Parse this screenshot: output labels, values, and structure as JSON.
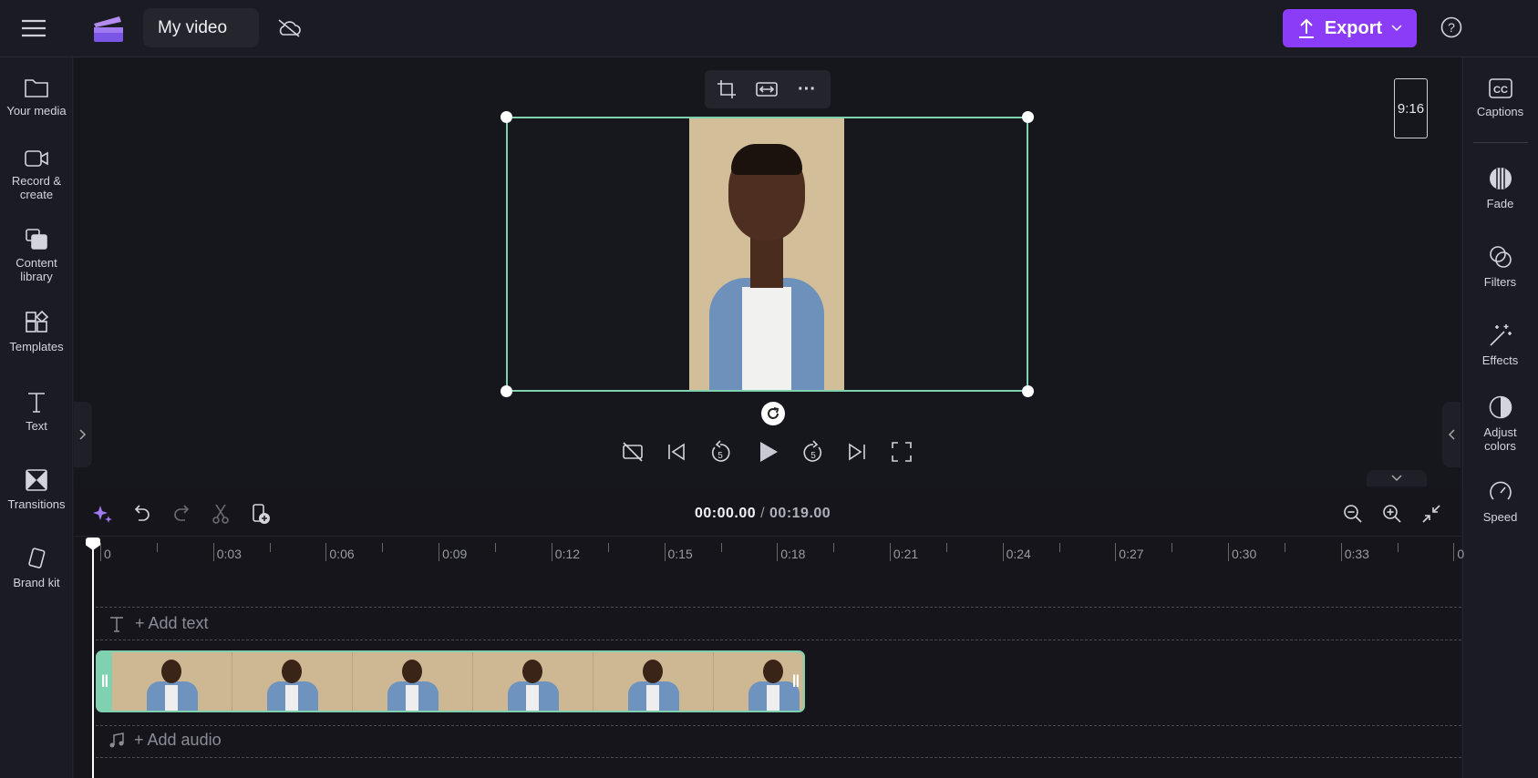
{
  "header": {
    "project_title": "My video",
    "export_label": "Export",
    "menu_icon": "hamburger-icon",
    "cloud_icon": "cloud-off-icon",
    "help_icon": "help-icon"
  },
  "left_nav": [
    {
      "label": "Your media",
      "icon": "folder-icon"
    },
    {
      "label": "Record &",
      "label2": "create",
      "icon": "camera-icon"
    },
    {
      "label": "Content",
      "label2": "library",
      "icon": "library-icon"
    },
    {
      "label": "Templates",
      "icon": "templates-icon"
    },
    {
      "label": "Text",
      "icon": "text-icon"
    },
    {
      "label": "Transitions",
      "icon": "transitions-icon"
    },
    {
      "label": "Brand kit",
      "icon": "brand-kit-icon"
    }
  ],
  "right_nav": [
    {
      "label": "Captions",
      "icon": "captions-icon"
    },
    {
      "label": "Fade",
      "icon": "fade-icon"
    },
    {
      "label": "Filters",
      "icon": "filters-icon"
    },
    {
      "label": "Effects",
      "icon": "effects-icon"
    },
    {
      "label": "Adjust",
      "label2": "colors",
      "icon": "adjust-colors-icon"
    },
    {
      "label": "Speed",
      "icon": "speed-icon"
    }
  ],
  "preview": {
    "aspect_ratio": "9:16"
  },
  "timeline": {
    "current_time": "00:00.00",
    "separator": " / ",
    "total_time": "00:19.00",
    "ruler": [
      "0",
      "0:03",
      "0:06",
      "0:09",
      "0:12",
      "0:15",
      "0:18",
      "0:21",
      "0:24",
      "0:27",
      "0:30",
      "0:33",
      "0"
    ],
    "add_text": "+ Add text",
    "add_audio": "+ Add audio"
  },
  "colors": {
    "accent": "#8b3cf6",
    "selection": "#7fd1b0"
  }
}
